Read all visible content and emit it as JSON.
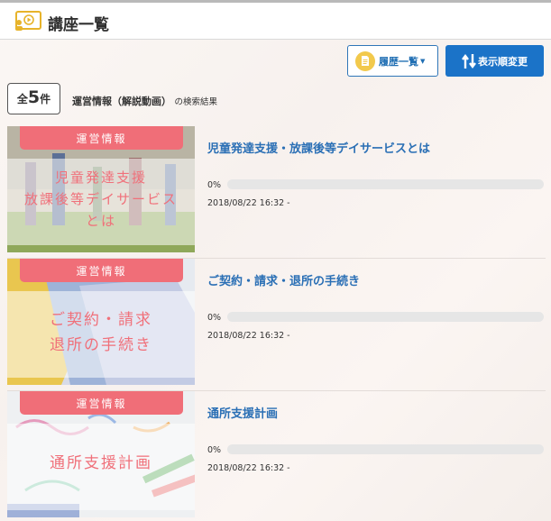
{
  "header": {
    "title": "講座一覧",
    "logo_icon": "video-lecture-icon"
  },
  "toolbar": {
    "history_label": "履歴一覧",
    "sort_label": "表示順変更"
  },
  "summary": {
    "count_prefix": "全",
    "count": "5",
    "count_suffix": "件",
    "query": "運営情報（解説動画）",
    "result_suffix": "の検索結果"
  },
  "colors": {
    "accent_blue": "#1b73c8",
    "badge_pink": "#f06e78",
    "title_blue": "#2a6fb5"
  },
  "items": [
    {
      "badge": "運営情報",
      "thumb_lines": [
        "児童発達支援",
        "放課後等デイサービス",
        "とは"
      ],
      "title": "児童発達支援・放課後等デイサービスとは",
      "progress_text": "0%",
      "progress": 0,
      "date": "2018/08/22 16:32 -"
    },
    {
      "badge": "運営情報",
      "thumb_lines": [
        "ご契約・請求",
        "退所の手続き"
      ],
      "title": "ご契約・請求・退所の手続き",
      "progress_text": "0%",
      "progress": 0,
      "date": "2018/08/22 16:32 -"
    },
    {
      "badge": "運営情報",
      "thumb_lines": [
        "通所支援計画"
      ],
      "title": "通所支援計画",
      "progress_text": "0%",
      "progress": 0,
      "date": "2018/08/22 16:32 -"
    }
  ]
}
